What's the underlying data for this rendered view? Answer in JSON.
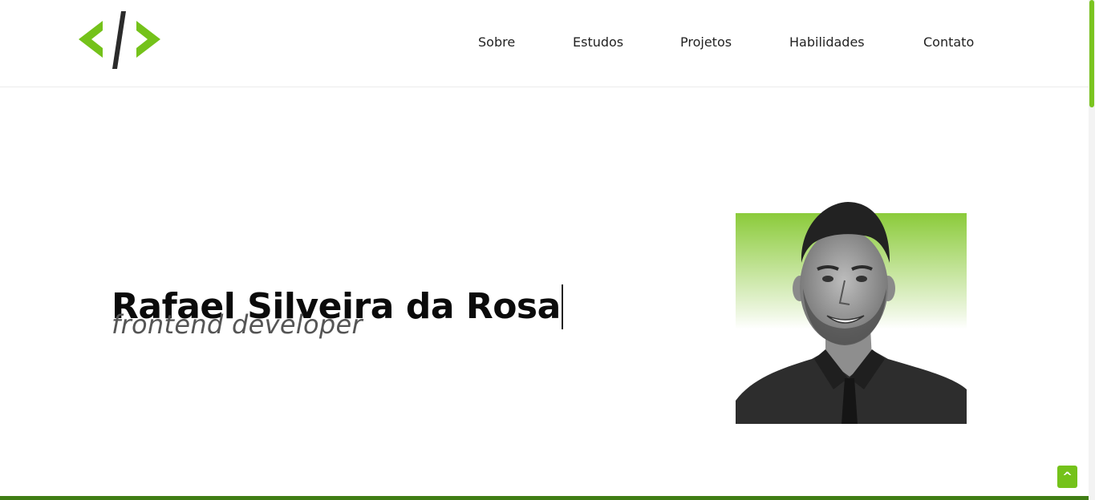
{
  "nav": {
    "items": [
      {
        "label": "Sobre"
      },
      {
        "label": "Estudos"
      },
      {
        "label": "Projetos"
      },
      {
        "label": "Habilidades"
      },
      {
        "label": "Contato"
      }
    ]
  },
  "hero": {
    "name": "Rafael Silveira da Rosa",
    "role": "frontend developer"
  },
  "scroll_top": {
    "label": "^"
  },
  "colors": {
    "accent": "#74c21a",
    "logo_dark": "#2b2b2b",
    "bottom_bar": "#3f7d14"
  },
  "icons": {
    "logo": "code-brackets-icon",
    "scroll_top": "chevron-up-icon"
  }
}
